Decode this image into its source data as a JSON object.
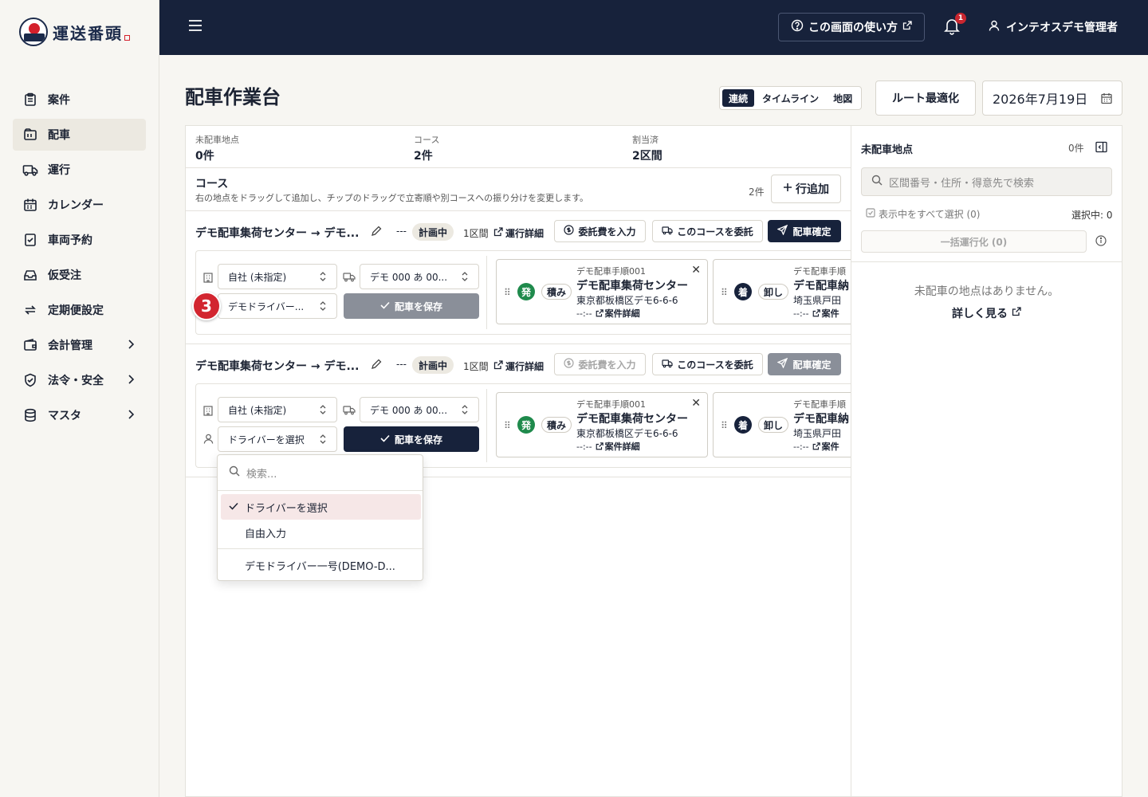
{
  "app": {
    "logo_text": "運送番頭"
  },
  "sidebar": {
    "items": [
      {
        "label": "案件",
        "icon": "clipboard-icon"
      },
      {
        "label": "配車",
        "icon": "dispatch-board-icon"
      },
      {
        "label": "運行",
        "icon": "truck-icon"
      },
      {
        "label": "カレンダー",
        "icon": "calendar-icon"
      },
      {
        "label": "車両予約",
        "icon": "checklist-icon"
      },
      {
        "label": "仮受注",
        "icon": "inbox-icon"
      },
      {
        "label": "定期便設定",
        "icon": "repeat-icon"
      },
      {
        "label": "会計管理",
        "icon": "wallet-icon"
      },
      {
        "label": "法令・安全",
        "icon": "shield-icon"
      },
      {
        "label": "マスタ",
        "icon": "database-icon"
      }
    ]
  },
  "topbar": {
    "help_label": "この画面の使い方",
    "notification_count": "1",
    "user_name": "インテオスデモ管理者"
  },
  "page": {
    "title": "配車作業台",
    "views": [
      "連続",
      "タイムライン",
      "地図"
    ],
    "active_view": "連続",
    "route_optimize_label": "ルート最適化",
    "date": "2026年7月19日"
  },
  "stats": [
    {
      "label": "未配車地点",
      "value": "0件"
    },
    {
      "label": "コース",
      "value": "2件"
    },
    {
      "label": "割当済",
      "value": "2区間"
    }
  ],
  "course_section": {
    "title": "コース",
    "description": "右の地点をドラッグして追加し、チップのドラッグで立寄順や別コースへの振り分けを変更します。",
    "count": "2件",
    "add_row_label": "行追加"
  },
  "courses": [
    {
      "name": "デモ配車集荷センター → デモ...",
      "dash": "---",
      "status": "計画中",
      "sections": "1区間",
      "operation_link": "運行詳細",
      "fee_label": "委託費を入力",
      "outsource_label": "このコースを委託",
      "confirm_label": "配車確定",
      "company": "自社 (未指定)",
      "vehicle": "デモ 000 あ 00...",
      "driver": "デモドライバー...",
      "save_label": "配車を保存",
      "stops": [
        {
          "badge": "発",
          "type": "積み",
          "seq": "デモ配車手順001",
          "name": "デモ配車集荷センター",
          "address": "東京都板橋区デモ6-6-6",
          "time": "--:--",
          "link": "案件詳細"
        },
        {
          "badge": "着",
          "type": "卸し",
          "seq": "デモ配車手順",
          "name": "デモ配車納",
          "address": "埼玉県戸田",
          "time": "--:--",
          "link": "案件"
        }
      ]
    },
    {
      "name": "デモ配車集荷センター → デモ...",
      "dash": "---",
      "status": "計画中",
      "sections": "1区間",
      "operation_link": "運行詳細",
      "fee_label": "委託費を入力",
      "outsource_label": "このコースを委託",
      "confirm_label": "配車確定",
      "company": "自社 (未指定)",
      "vehicle": "デモ 000 あ 00...",
      "driver": "ドライバーを選択",
      "save_label": "配車を保存",
      "stops": [
        {
          "badge": "発",
          "type": "積み",
          "seq": "デモ配車手順001",
          "name": "デモ配車集荷センター",
          "address": "東京都板橋区デモ6-6-6",
          "time": "--:--",
          "link": "案件詳細"
        },
        {
          "badge": "着",
          "type": "卸し",
          "seq": "デモ配車手順",
          "name": "デモ配車納",
          "address": "埼玉県戸田",
          "time": "--:--",
          "link": "案件"
        }
      ]
    }
  ],
  "step_marker": "3",
  "dropdown": {
    "search_placeholder": "検索...",
    "options": [
      "ドライバーを選択",
      "自由入力",
      "デモドライバー一号(DEMO-D..."
    ],
    "selected": "ドライバーを選択"
  },
  "right_panel": {
    "title": "未配車地点",
    "count": "0件",
    "search_placeholder": "区間番号・住所・得意先で検索",
    "select_all": "表示中をすべて選択 (0)",
    "selected_count": "選択中: 0",
    "bulk_label": "一括運行化 (0)",
    "empty_text": "未配車の地点はありません。",
    "more_label": "詳しく見る"
  },
  "colors": {
    "navy": "#17223b",
    "green_badge": "#1f8a4c",
    "red_marker": "#d2252f",
    "muted_button": "#8a8f99"
  }
}
